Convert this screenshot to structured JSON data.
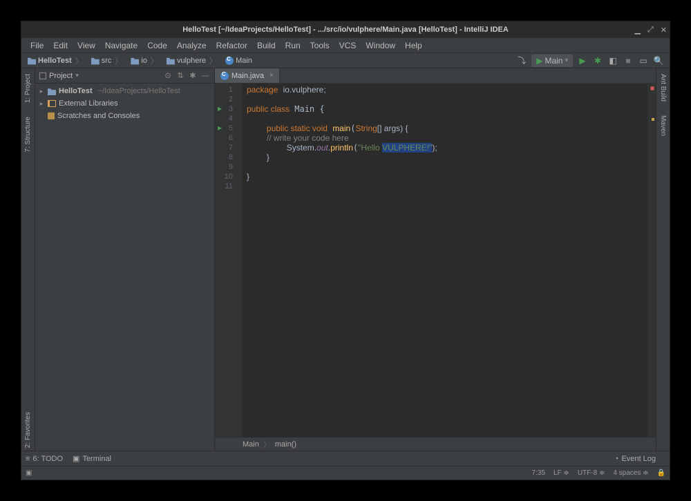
{
  "title": "HelloTest [~/IdeaProjects/HelloTest] - .../src/io/vulphere/Main.java [HelloTest] - IntelliJ IDEA",
  "menu": [
    "File",
    "Edit",
    "View",
    "Navigate",
    "Code",
    "Analyze",
    "Refactor",
    "Build",
    "Run",
    "Tools",
    "VCS",
    "Window",
    "Help"
  ],
  "breadcrumb": [
    {
      "icon": "folder",
      "label": "HelloTest",
      "bold": true
    },
    {
      "icon": "folder",
      "label": "src"
    },
    {
      "icon": "folder",
      "label": "io"
    },
    {
      "icon": "folder",
      "label": "vulphere"
    },
    {
      "icon": "class",
      "label": "Main"
    }
  ],
  "run_config": "Main",
  "left_rail": [
    "1: Project",
    "7: Structure",
    "2: Favorites"
  ],
  "right_rail": [
    "Ant Build",
    "Maven"
  ],
  "project_header": "Project",
  "tree": {
    "root_name": "HelloTest",
    "root_path": "~/IdeaProjects/HelloTest",
    "ext_libs": "External Libraries",
    "scratches": "Scratches and Consoles"
  },
  "tab": "Main.java",
  "editor_bc": [
    "Main",
    "main()"
  ],
  "bottom": {
    "todo": "6: TODO",
    "terminal": "Terminal",
    "eventlog": "Event Log"
  },
  "status": {
    "pos": "7:35",
    "lf": "LF",
    "enc": "UTF-8",
    "indent": "4 spaces"
  },
  "code": {
    "l1_pkg": "package",
    "l1_p": "io.vulphere;",
    "l3": "public class Main {",
    "l5_a": "public static void",
    "l5_b": "main",
    "l5_c": "String",
    "l5_d": "[] args) {",
    "l6": "// write your code here",
    "l7_a": "System",
    "l7_b": ".out.",
    "l7_c": "println",
    "l7_d": "\"Hello ",
    "l7_e": "VULPHERE!\"",
    "l7_f": ");",
    "l8": "}",
    "l10": "}"
  }
}
